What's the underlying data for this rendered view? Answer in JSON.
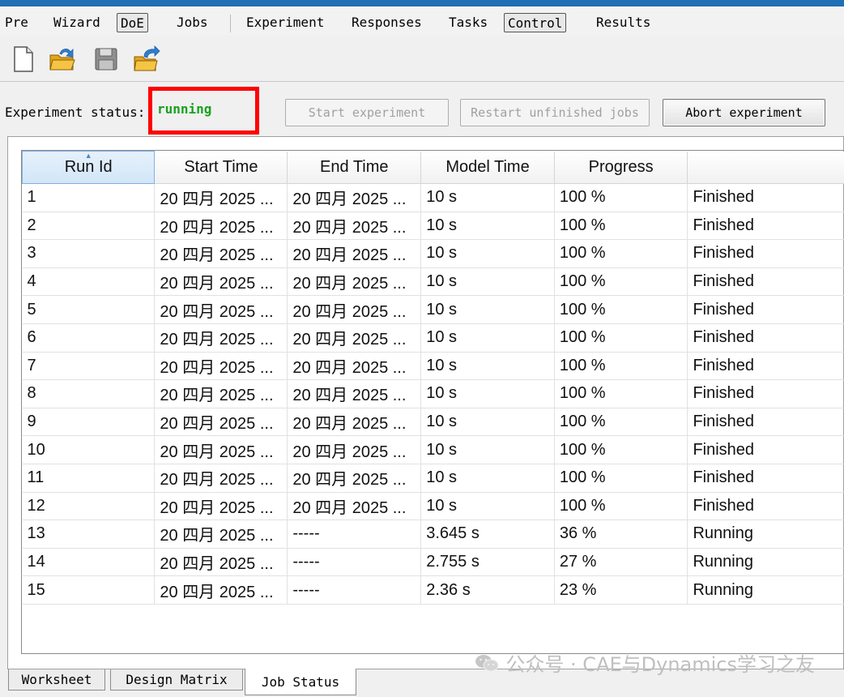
{
  "menubar": {
    "items": [
      {
        "label": "Pre",
        "boxed": false
      },
      {
        "label": "Wizard",
        "boxed": false
      },
      {
        "label": "DoE",
        "boxed": true
      },
      {
        "label": "Jobs",
        "boxed": false
      },
      {
        "label": "Experiment",
        "boxed": false
      },
      {
        "label": "Responses",
        "boxed": false
      },
      {
        "label": "Tasks",
        "boxed": false
      },
      {
        "label": "Control",
        "boxed": true
      },
      {
        "label": "Results",
        "boxed": false
      }
    ]
  },
  "toolbar": {
    "icons": [
      "new-file-icon",
      "open-folder-icon",
      "save-disk-icon",
      "export-folder-icon"
    ]
  },
  "status": {
    "label": "Experiment status:",
    "value": "running",
    "value_color": "#19a11e"
  },
  "buttons": {
    "start": "Start experiment",
    "restart": "Restart unfinished jobs",
    "abort": "Abort experiment"
  },
  "table": {
    "columns": [
      "Run Id",
      "Start Time",
      "End Time",
      "Model Time",
      "Progress",
      ""
    ],
    "rows": [
      [
        "1",
        "20 四月 2025 ...",
        "20 四月 2025 ...",
        "10 s",
        "100 %",
        "Finished"
      ],
      [
        "2",
        "20 四月 2025 ...",
        "20 四月 2025 ...",
        "10 s",
        "100 %",
        "Finished"
      ],
      [
        "3",
        "20 四月 2025 ...",
        "20 四月 2025 ...",
        "10 s",
        "100 %",
        "Finished"
      ],
      [
        "4",
        "20 四月 2025 ...",
        "20 四月 2025 ...",
        "10 s",
        "100 %",
        "Finished"
      ],
      [
        "5",
        "20 四月 2025 ...",
        "20 四月 2025 ...",
        "10 s",
        "100 %",
        "Finished"
      ],
      [
        "6",
        "20 四月 2025 ...",
        "20 四月 2025 ...",
        "10 s",
        "100 %",
        "Finished"
      ],
      [
        "7",
        "20 四月 2025 ...",
        "20 四月 2025 ...",
        "10 s",
        "100 %",
        "Finished"
      ],
      [
        "8",
        "20 四月 2025 ...",
        "20 四月 2025 ...",
        "10 s",
        "100 %",
        "Finished"
      ],
      [
        "9",
        "20 四月 2025 ...",
        "20 四月 2025 ...",
        "10 s",
        "100 %",
        "Finished"
      ],
      [
        "10",
        "20 四月 2025 ...",
        "20 四月 2025 ...",
        "10 s",
        "100 %",
        "Finished"
      ],
      [
        "11",
        "20 四月 2025 ...",
        "20 四月 2025 ...",
        "10 s",
        "100 %",
        "Finished"
      ],
      [
        "12",
        "20 四月 2025 ...",
        "20 四月 2025 ...",
        "10 s",
        "100 %",
        "Finished"
      ],
      [
        "13",
        "20 四月 2025 ...",
        "-----",
        "3.645 s",
        "36 %",
        "Running"
      ],
      [
        "14",
        "20 四月 2025 ...",
        "-----",
        "2.755 s",
        "27 %",
        "Running"
      ],
      [
        "15",
        "20 四月 2025 ...",
        "-----",
        "2.36 s",
        "23 %",
        "Running"
      ]
    ]
  },
  "tabs": [
    {
      "label": "Worksheet",
      "active": false
    },
    {
      "label": "Design Matrix",
      "active": false
    },
    {
      "label": "Job Status",
      "active": true
    }
  ],
  "watermark": {
    "text": "公众号 · CAE与Dynamics学习之友"
  },
  "colors": {
    "highlight": "#ff0000",
    "title_bar": "#1f6fb5"
  }
}
